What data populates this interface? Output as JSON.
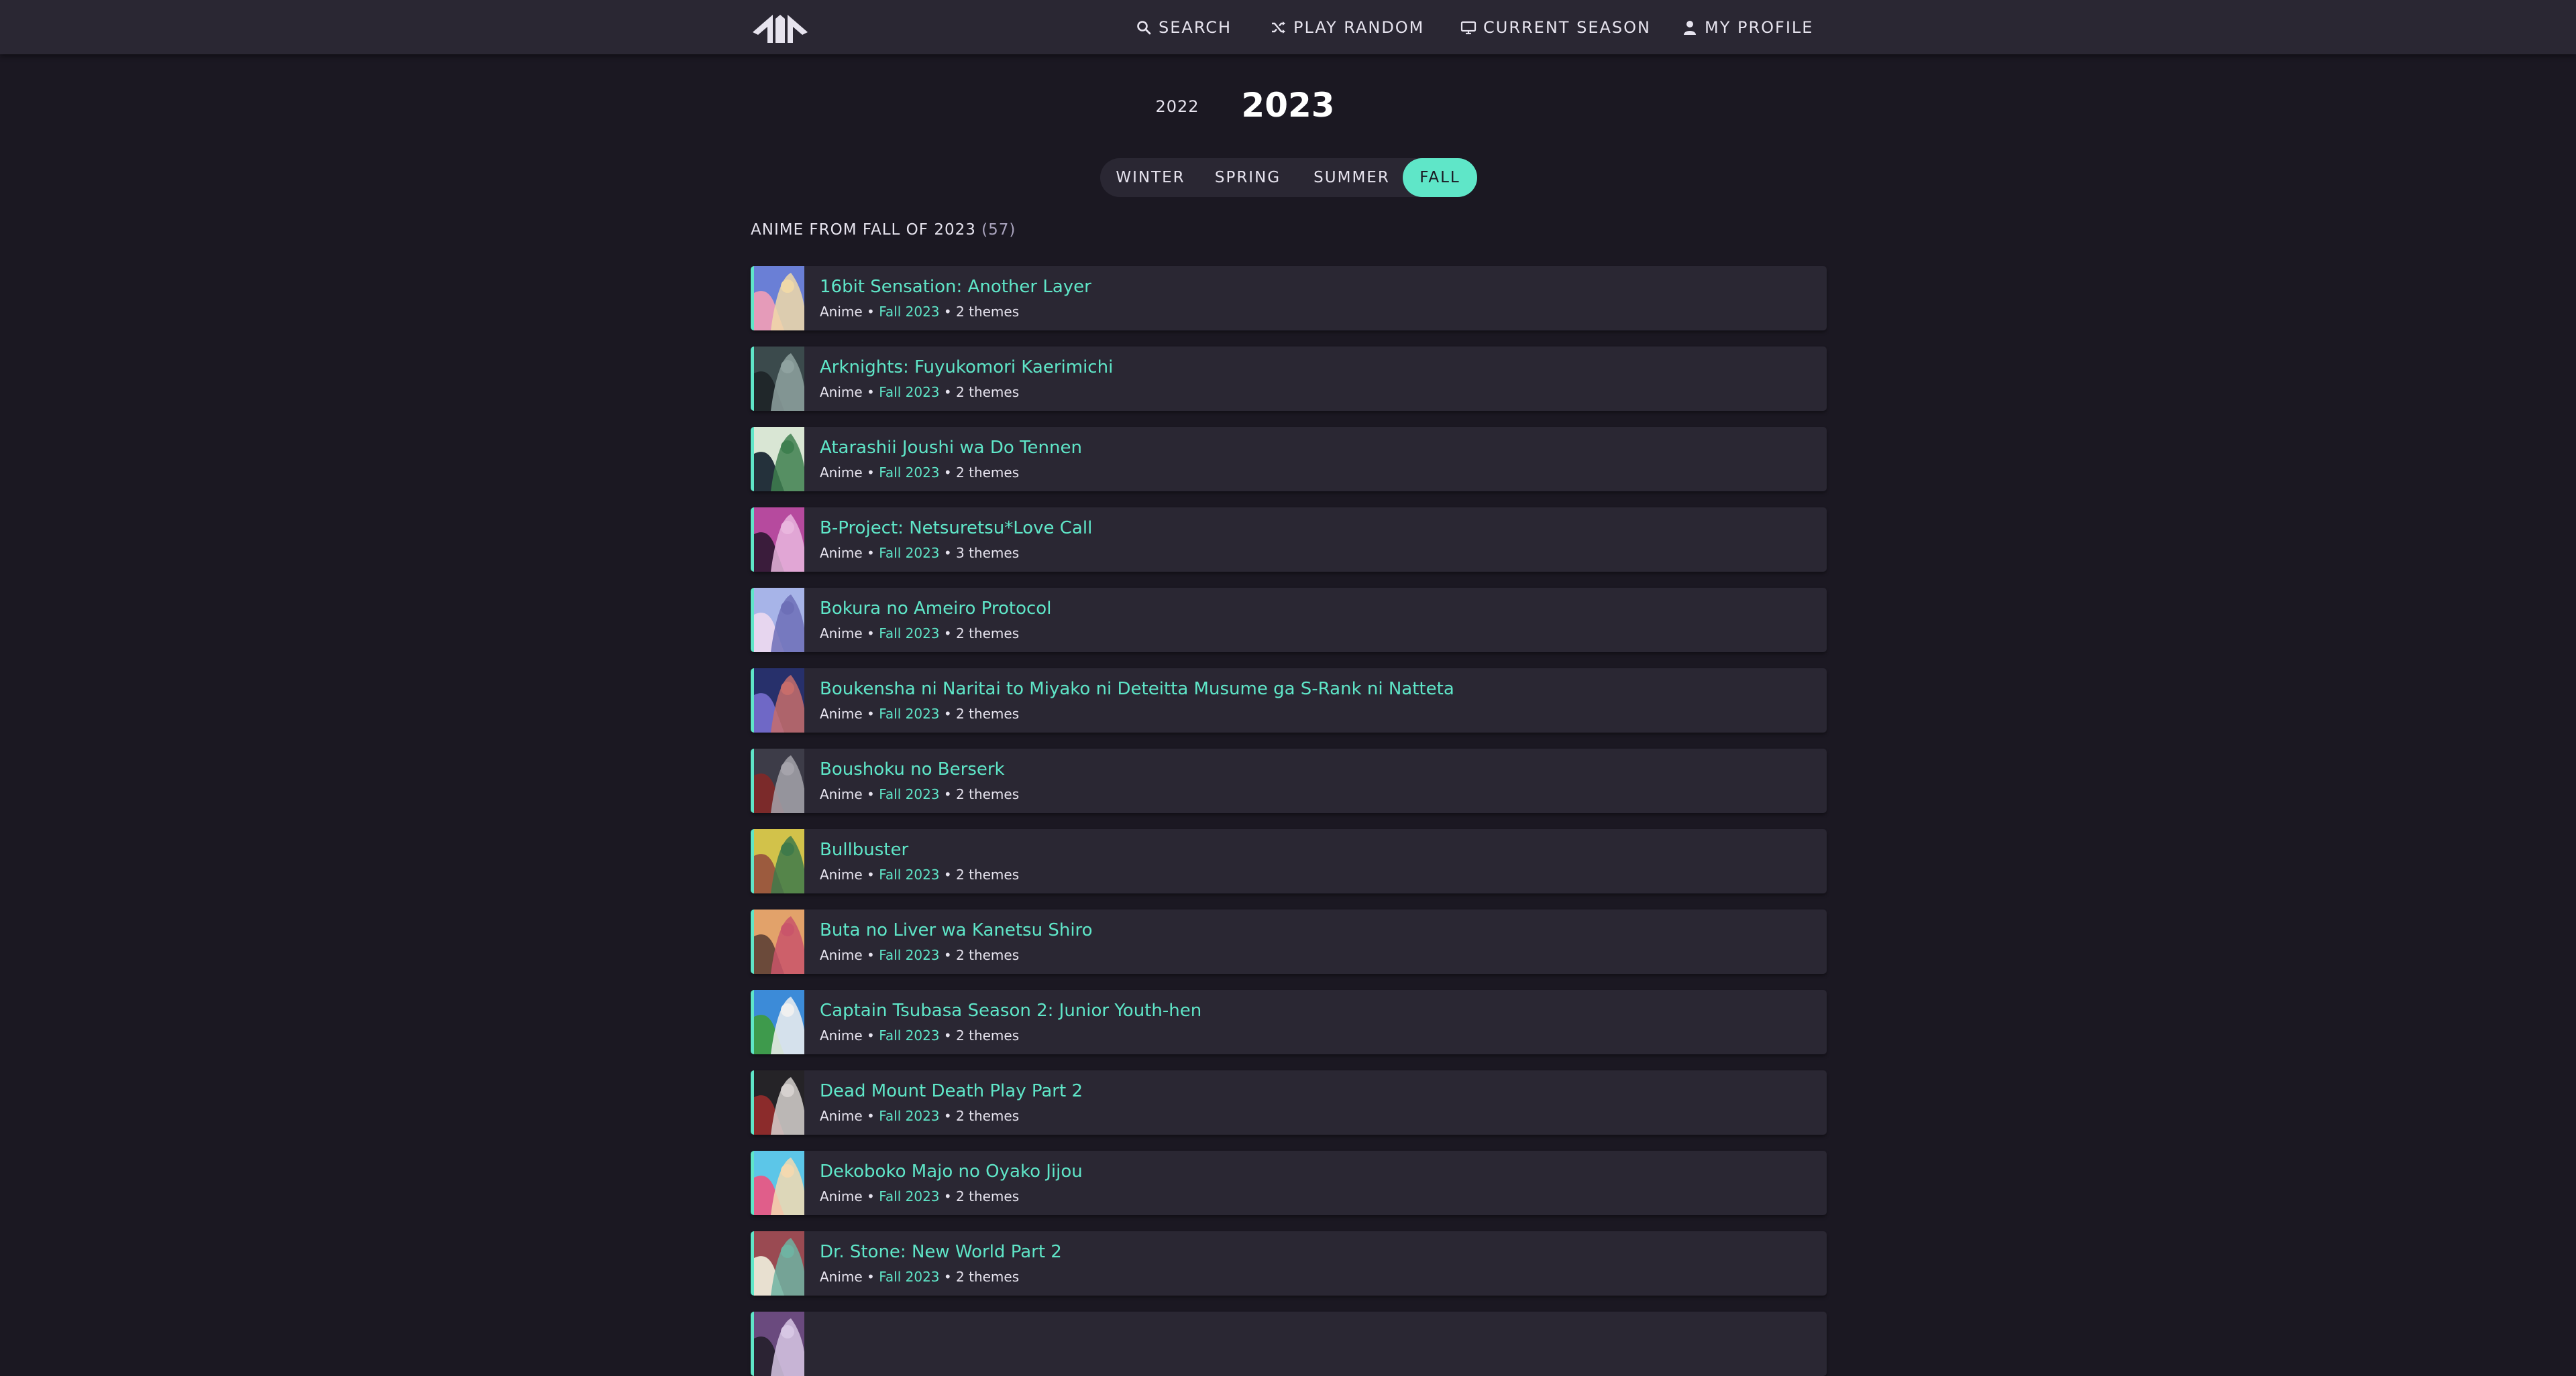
{
  "nav": {
    "search": "SEARCH",
    "play_random": "PLAY RANDOM",
    "current_season": "CURRENT SEASON",
    "my_profile": "MY PROFILE"
  },
  "year_selector": {
    "previous": "2022",
    "current": "2023"
  },
  "season_tabs": [
    {
      "label": "WINTER",
      "active": false
    },
    {
      "label": "SPRING",
      "active": false
    },
    {
      "label": "SUMMER",
      "active": false
    },
    {
      "label": "FALL",
      "active": true
    }
  ],
  "section": {
    "heading": "ANIME FROM FALL OF 2023",
    "count": "(57)"
  },
  "colors": {
    "accent": "#5fe6c8",
    "background": "#1b1822",
    "card": "#2a2733"
  },
  "anime": [
    {
      "title": "16bit Sensation: Another Layer",
      "type": "Anime",
      "season": "Fall 2023",
      "themes": "2 themes",
      "thumb_colors": [
        "#6a7fd6",
        "#f0d9a8",
        "#e59bb9"
      ]
    },
    {
      "title": "Arknights: Fuyukomori Kaerimichi",
      "type": "Anime",
      "season": "Fall 2023",
      "themes": "2 themes",
      "thumb_colors": [
        "#3b4a4c",
        "#8fa2a0",
        "#20272a"
      ]
    },
    {
      "title": "Atarashii Joushi wa Do Tennen",
      "type": "Anime",
      "season": "Fall 2023",
      "themes": "2 themes",
      "thumb_colors": [
        "#d9e6d4",
        "#3e7f4f",
        "#24313b"
      ]
    },
    {
      "title": "B-Project: Netsuretsu*Love Call",
      "type": "Anime",
      "season": "Fall 2023",
      "themes": "3 themes",
      "thumb_colors": [
        "#b64a9e",
        "#e9b6de",
        "#3a1c3b"
      ]
    },
    {
      "title": "Bokura no Ameiro Protocol",
      "type": "Anime",
      "season": "Fall 2023",
      "themes": "2 themes",
      "thumb_colors": [
        "#a7b4e8",
        "#6d6fb7",
        "#e7d6ef"
      ]
    },
    {
      "title": "Boukensha ni Naritai to Miyako ni Deteitta Musume ga S-Rank ni Natteta",
      "type": "Anime",
      "season": "Fall 2023",
      "themes": "2 themes",
      "thumb_colors": [
        "#27306b",
        "#c76d6b",
        "#6f68c6"
      ]
    },
    {
      "title": "Boushoku no Berserk",
      "type": "Anime",
      "season": "Fall 2023",
      "themes": "2 themes",
      "thumb_colors": [
        "#3d3c48",
        "#a5a3ab",
        "#7b2a2a"
      ]
    },
    {
      "title": "Bullbuster",
      "type": "Anime",
      "season": "Fall 2023",
      "themes": "2 themes",
      "thumb_colors": [
        "#d2c24a",
        "#3f7a4a",
        "#9c5b3e"
      ]
    },
    {
      "title": "Buta no Liver wa Kanetsu Shiro",
      "type": "Anime",
      "season": "Fall 2023",
      "themes": "2 themes",
      "thumb_colors": [
        "#e2a26a",
        "#c9556a",
        "#6b4a3a"
      ]
    },
    {
      "title": "Captain Tsubasa Season 2: Junior Youth-hen",
      "type": "Anime",
      "season": "Fall 2023",
      "themes": "2 themes",
      "thumb_colors": [
        "#3c8bd8",
        "#f0f0f0",
        "#3e9a4c"
      ]
    },
    {
      "title": "Dead Mount Death Play Part 2",
      "type": "Anime",
      "season": "Fall 2023",
      "themes": "2 themes",
      "thumb_colors": [
        "#252327",
        "#d6d1cf",
        "#8b2b2b"
      ]
    },
    {
      "title": "Dekoboko Majo no Oyako Jijou",
      "type": "Anime",
      "season": "Fall 2023",
      "themes": "2 themes",
      "thumb_colors": [
        "#5cc6e8",
        "#f3d9b0",
        "#e05e8a"
      ]
    },
    {
      "title": "Dr. Stone: New World Part 2",
      "type": "Anime",
      "season": "Fall 2023",
      "themes": "2 themes",
      "thumb_colors": [
        "#9a4a52",
        "#6fb3a2",
        "#e8e0d0"
      ]
    },
    {
      "title": "",
      "type": "",
      "season": "",
      "themes": "",
      "thumb_colors": [
        "#6a4a7e",
        "#d7c7e4",
        "#2b2333"
      ]
    }
  ]
}
